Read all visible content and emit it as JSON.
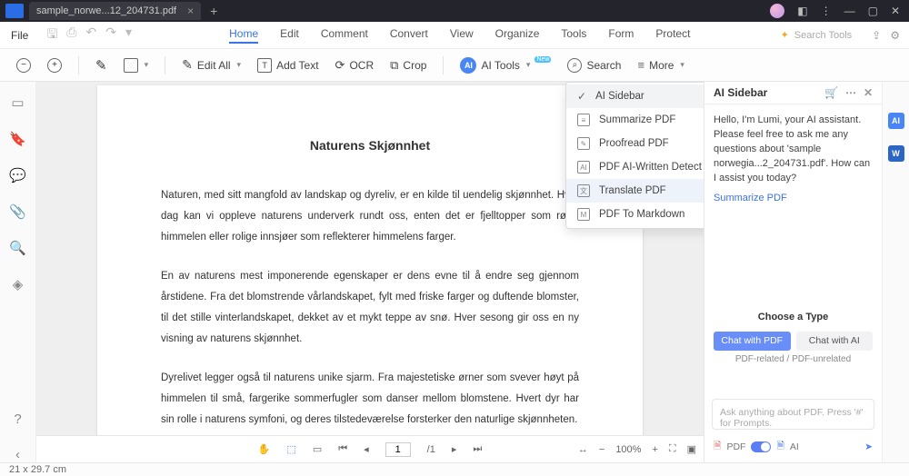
{
  "titlebar": {
    "tab_title": "sample_norwe...12_204731.pdf"
  },
  "menubar": {
    "file": "File",
    "items": [
      "Home",
      "Edit",
      "Comment",
      "Convert",
      "View",
      "Organize",
      "Tools",
      "Form",
      "Protect"
    ],
    "active_index": 0,
    "search_placeholder": "Search Tools"
  },
  "toolbar": {
    "edit_all": "Edit All",
    "add_text": "Add Text",
    "ocr": "OCR",
    "crop": "Crop",
    "ai_tools": "AI Tools",
    "search": "Search",
    "more": "More"
  },
  "ai_dropdown": {
    "items": [
      {
        "label": "AI Sidebar",
        "sel": true
      },
      {
        "label": "Summarize PDF"
      },
      {
        "label": "Proofread PDF"
      },
      {
        "label": "PDF AI-Written Detect"
      },
      {
        "label": "Translate PDF",
        "hover": true
      },
      {
        "label": "PDF To Markdown"
      }
    ]
  },
  "document": {
    "title": "Naturens Skjønnhet",
    "p1": "Naturen, med sitt mangfold av landskap og dyreliv, er en kilde til uendelig skjønnhet. Hver dag kan vi oppleve naturens underverk rundt oss, enten det er fjelltopper som rører himmelen eller rolige innsjøer som reflekterer himmelens farger.",
    "p2": "En av naturens mest imponerende egenskaper er dens evne til å endre seg gjennom årstidene. Fra det blomstrende vårlandskapet, fylt med friske farger og duftende blomster, til det stille vinterlandskapet, dekket av et mykt teppe av snø. Hver sesong gir oss en ny visning av naturens skjønnhet.",
    "p3": "Dyrelivet legger også til naturens unike sjarm. Fra majestetiske ørner som svever høyt på himmelen til små, fargerike sommerfugler som danser mellom blomstene. Hvert dyr har sin rolle i naturens symfoni, og deres tilstedeværelse forsterker den naturlige skjønnheten."
  },
  "sidebar": {
    "title": "AI Sidebar",
    "greeting": "Hello, I'm Lumi, your AI assistant. Please feel free to ask me any questions about 'sample norwegia...2_204731.pdf'. How can I assist you today?",
    "summarize_link": "Summarize PDF",
    "choose_type": "Choose a Type",
    "chat_with_pdf": "Chat with PDF",
    "chat_with_ai": "Chat with AI",
    "related_unrelated": "PDF-related / PDF-unrelated",
    "ask_placeholder": "Ask anything about PDF. Press '#' for Prompts.",
    "pdf_label": "PDF",
    "ai_label": "AI"
  },
  "pagefooter": {
    "page_current": "1",
    "page_total": "/1"
  },
  "statusbar": {
    "page_size": "21 x 29.7 cm",
    "zoom": "100%"
  }
}
